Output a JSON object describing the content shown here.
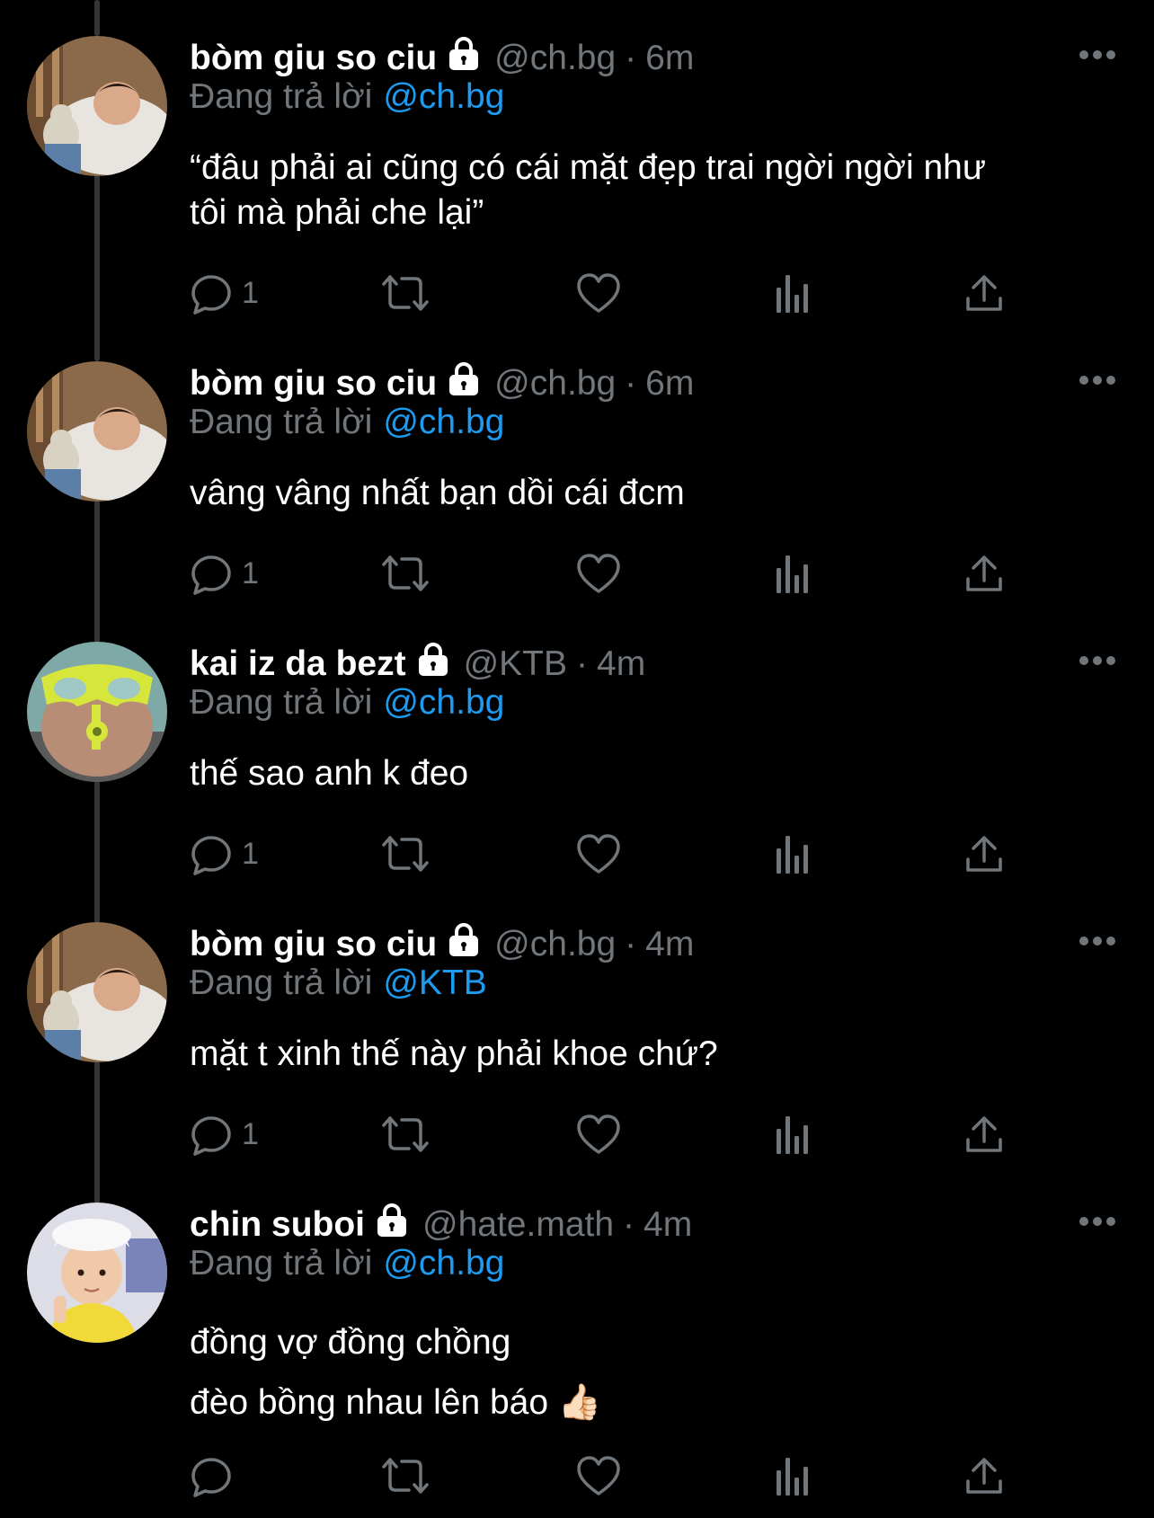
{
  "colors": {
    "background": "#000000",
    "text_primary": "#ffffff",
    "text_secondary": "#71767b",
    "mention": "#1d9bf0",
    "thread_line": "#333639"
  },
  "labels": {
    "replying_to": "Đang trả lời",
    "more_icon": "more-horizontal-icon",
    "lock_icon": "lock-icon",
    "reply_icon": "reply-icon",
    "retweet_icon": "retweet-icon",
    "like_icon": "heart-icon",
    "views_icon": "views-icon",
    "share_icon": "share-icon"
  },
  "tweets": [
    {
      "name": "bòm giu so ciu",
      "handle": "@ch.bg",
      "time": "6m",
      "reply_to": "@ch.bg",
      "text": [
        "“đâu phải ai cũng có cái mặt đẹp trai ngời ngời như",
        "tôi mà phải che lại”"
      ],
      "reply_count": "1"
    },
    {
      "name": "bòm giu so ciu",
      "handle": "@ch.bg",
      "time": "6m",
      "reply_to": "@ch.bg",
      "text": [
        "vâng vâng nhất bạn dồi cái đcm"
      ],
      "reply_count": "1"
    },
    {
      "name": "kai iz da bezt",
      "handle": "@KTB",
      "time": "4m",
      "reply_to": "@ch.bg",
      "text": [
        "thế sao anh k đeo"
      ],
      "reply_count": "1"
    },
    {
      "name": "bòm giu so ciu",
      "handle": "@ch.bg",
      "time": "4m",
      "reply_to": "@KTB",
      "text": [
        "mặt t xinh thế này phải khoe chứ?"
      ],
      "reply_count": "1"
    },
    {
      "name": "chin suboi",
      "handle": "@hate.math",
      "time": "4m",
      "reply_to": "@ch.bg",
      "text": [
        "đồng vợ đồng chồng",
        "đèo bồng nhau lên báo 👍🏻"
      ],
      "reply_count": ""
    }
  ]
}
